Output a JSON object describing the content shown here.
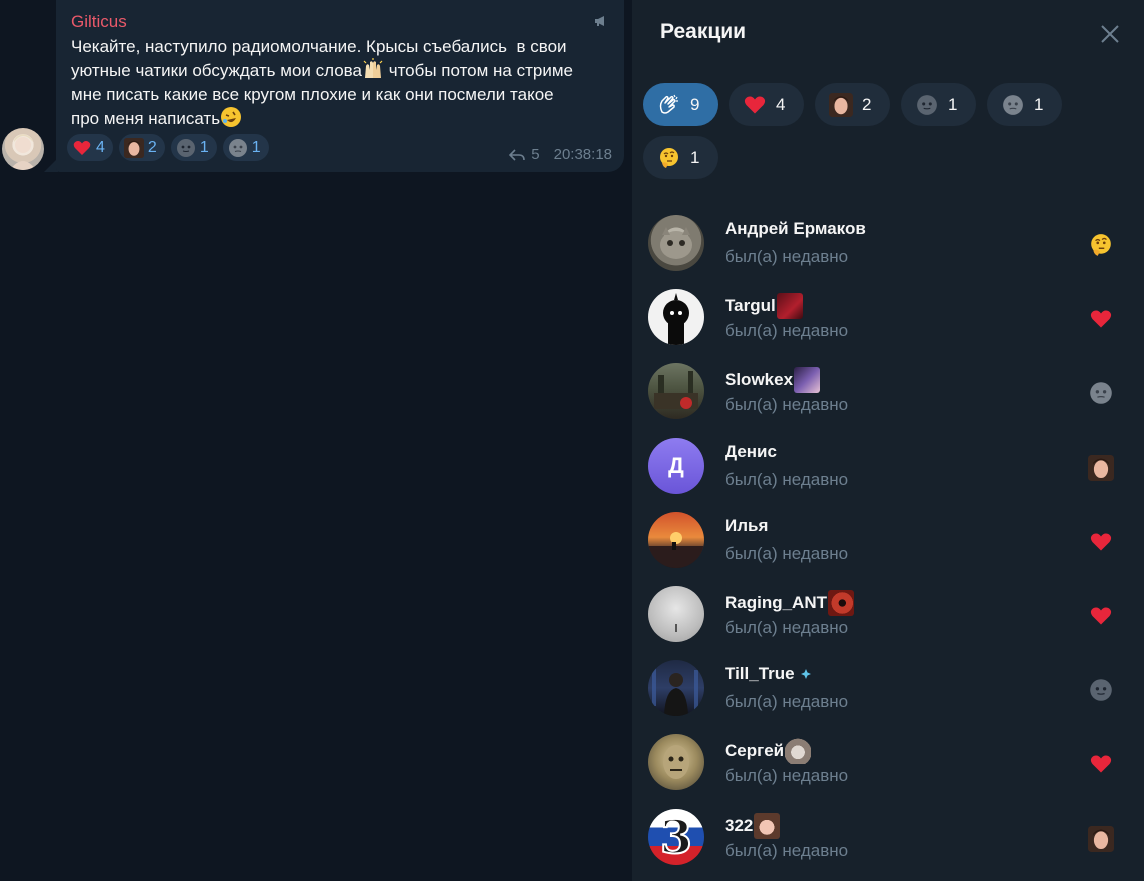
{
  "message": {
    "sender": "Gilticus",
    "text": {
      "part1": "Чекайте, наступило радиомолчание. Крысы съебались  в свои\nуютные чатики обсуждать мои слова",
      "part2": " чтобы потом на стриме\nмне писать какие все кругом плохие и как они посмели такое\nпро меня написать"
    },
    "reactions": [
      {
        "icon": "heart-icon",
        "count": "4"
      },
      {
        "icon": "face-sticker-icon",
        "count": "2"
      },
      {
        "icon": "moon-face-icon",
        "count": "1"
      },
      {
        "icon": "gray-face-icon",
        "count": "1"
      }
    ],
    "replies": "5",
    "time": "20:38:18"
  },
  "panel": {
    "title": "Реакции",
    "filters": [
      {
        "icon": "clapping-hands-icon",
        "count": "9",
        "active": true
      },
      {
        "icon": "heart-icon",
        "count": "4"
      },
      {
        "icon": "face-sticker-icon",
        "count": "2"
      },
      {
        "icon": "moon-face-icon",
        "count": "1"
      },
      {
        "icon": "gray-face-icon",
        "count": "1"
      },
      {
        "icon": "thinking-face-icon",
        "count": "1"
      }
    ],
    "users": [
      {
        "name": "Андрей Ермаков",
        "status": "был(а) недавно",
        "reaction": "thinking-face-icon"
      },
      {
        "name": "Targul",
        "status": "был(а) недавно",
        "reaction": "heart-icon"
      },
      {
        "name": "Slowkex",
        "status": "был(а) недавно",
        "reaction": "gray-face-icon"
      },
      {
        "name": "Денис",
        "status": "был(а) недавно",
        "reaction": "face-sticker-icon",
        "initial": "Д"
      },
      {
        "name": "Илья",
        "status": "был(а) недавно",
        "reaction": "heart-icon"
      },
      {
        "name": "Raging_ANT",
        "status": "был(а) недавно",
        "reaction": "heart-icon"
      },
      {
        "name": "Till_True",
        "status": "был(а) недавно",
        "reaction": "moon-face-icon"
      },
      {
        "name": "Сергей",
        "status": "был(а) недавно",
        "reaction": "heart-icon"
      },
      {
        "name": "322",
        "status": "был(а) недавно",
        "reaction": "face-sticker-icon",
        "initial": "3"
      }
    ]
  },
  "colors": {
    "accent": "#2f6ea5",
    "sender": "#e9596a",
    "heart": "#e8263b",
    "link": "#6ab2f2",
    "muted": "#6d7f8f"
  }
}
